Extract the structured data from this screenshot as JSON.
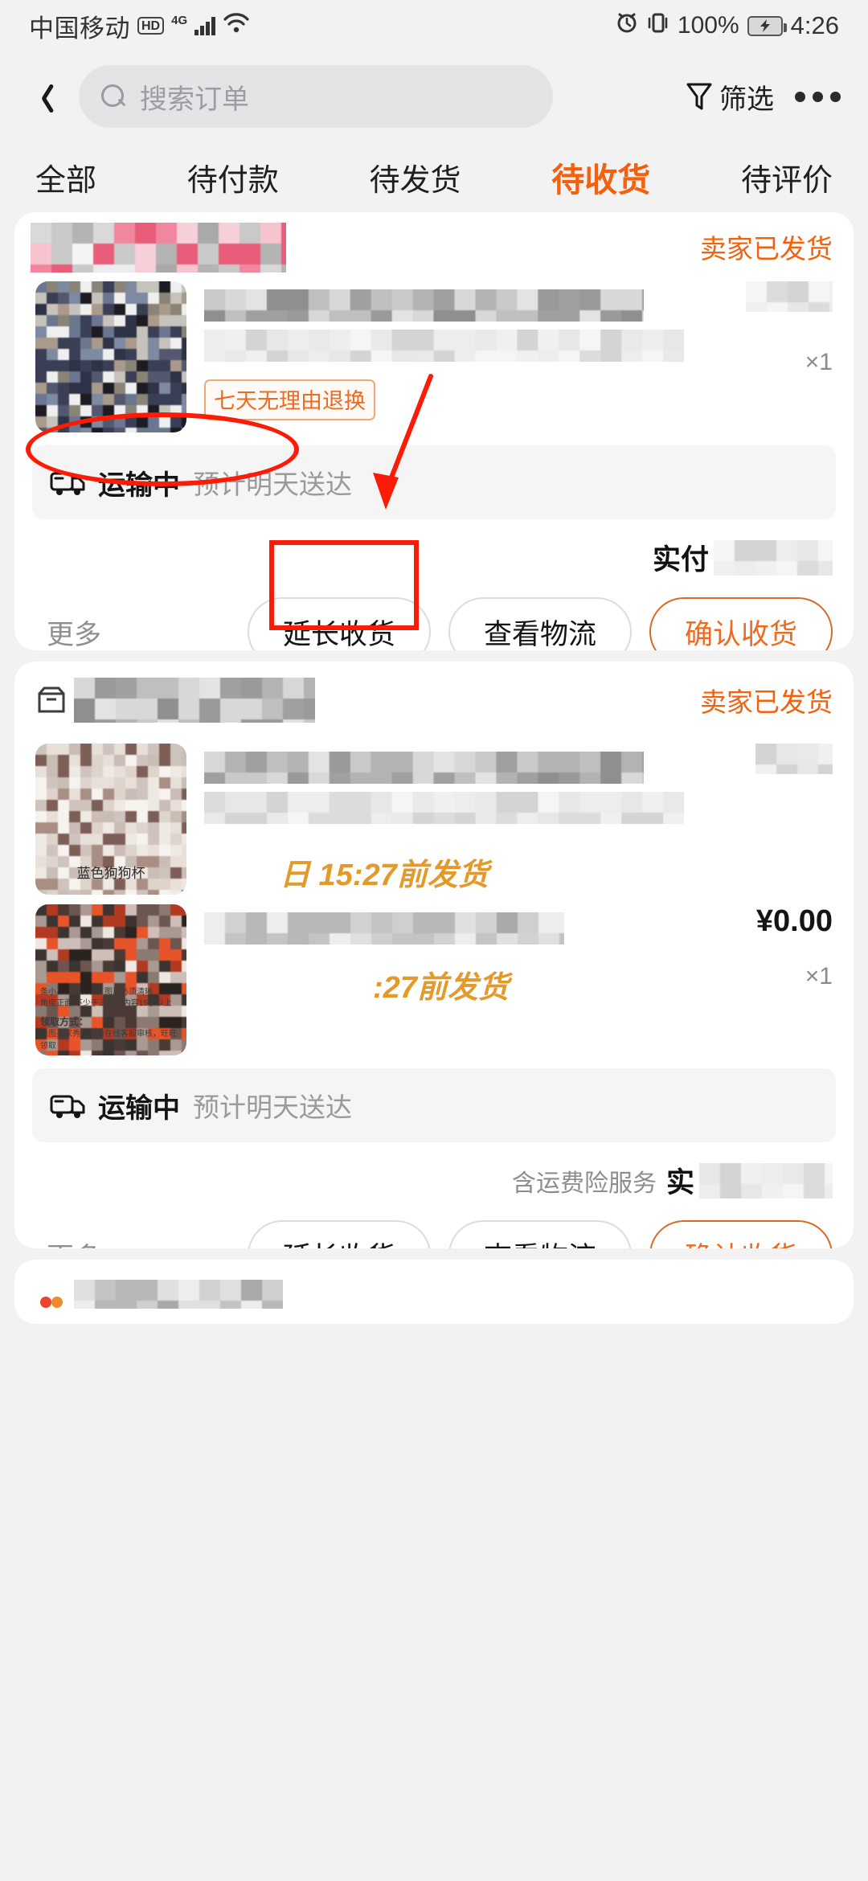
{
  "status_bar": {
    "carrier": "中国移动",
    "hd": "HD",
    "network": "4G",
    "battery_percent": "100%",
    "time": "4:26",
    "icons": [
      "alarm-icon",
      "vibrate-icon",
      "battery-charging-icon",
      "wifi-icon",
      "signal-bars-icon"
    ]
  },
  "header": {
    "back_icon": "chevron-left-icon",
    "search_placeholder": "搜索订单",
    "search_value": "",
    "filter_label": "筛选",
    "filter_icon": "funnel-icon",
    "more_icon": "more-dots-icon"
  },
  "tabs": [
    {
      "label": "全部",
      "active": false
    },
    {
      "label": "待付款",
      "active": false
    },
    {
      "label": "待发货",
      "active": false
    },
    {
      "label": "待收货",
      "active": true
    },
    {
      "label": "待评价",
      "active": false
    }
  ],
  "theme": {
    "accent": "#f4600c",
    "accent_button": "#ee6a20",
    "annotation_red": "#fb1b07",
    "page_bg": "#f2f2f2",
    "card_bg": "#ffffff",
    "muted_text": "#8f8f8f"
  },
  "orders": [
    {
      "shop_name": "",
      "shop_name_blurred": true,
      "status": "卖家已发货",
      "status_blurred_overlay": true,
      "goods": [
        {
          "title": "",
          "title_blurred": true,
          "tag": "七天无理由退换",
          "price": "",
          "price_blurred": true,
          "qty": "×1",
          "image_caption": ""
        }
      ],
      "logistics": {
        "state": "运输中",
        "eta": "预计明天送达",
        "icon": "truck-icon"
      },
      "payment": {
        "freight_note": "",
        "label": "实付",
        "amount": "",
        "amount_blurred": true
      },
      "buttons": [
        {
          "label": "更多",
          "style": "text"
        },
        {
          "label": "延长收货",
          "style": "outline"
        },
        {
          "label": "查看物流",
          "style": "outline"
        },
        {
          "label": "确认收货",
          "style": "primary"
        }
      ]
    },
    {
      "shop_name": "",
      "shop_name_blurred": true,
      "status": "卖家已发货",
      "goods": [
        {
          "title": "",
          "title_blurred": true,
          "deadline_text": "日 15:27前发货",
          "price": "",
          "qty": "",
          "image_caption": "蓝色狗狗杯"
        },
        {
          "title": "",
          "title_blurred": true,
          "deadline_text": ":27前发货",
          "price": "¥0.00",
          "qty": "×1",
          "image_caption": "",
          "image_text_lines": [
            "条小、、、、、、、、、、，图片必须清晰",
            "角度正面,不少于三张，内容15字以上",
            "领取方式：",
            "截图买家秀图片给在线客服审核，旺旺领取"
          ]
        }
      ],
      "logistics": {
        "state": "运输中",
        "eta": "预计明天送达",
        "icon": "truck-icon"
      },
      "payment": {
        "freight_note": "含运费险服务",
        "label": "实",
        "amount": "",
        "amount_blurred": true
      },
      "buttons": [
        {
          "label": "更多",
          "style": "text"
        },
        {
          "label": "延长收货",
          "style": "outline"
        },
        {
          "label": "查看物流",
          "style": "outline"
        },
        {
          "label": "确认收货",
          "style": "primary"
        }
      ]
    },
    {
      "shop_name": "",
      "status": "",
      "partial": true
    }
  ],
  "annotations": [
    {
      "type": "ellipse",
      "target": "logistics-row-order-1",
      "color": "#fb1b07"
    },
    {
      "type": "arrow",
      "from_to": "pointing-to-view-logistics",
      "color": "#fb1b07"
    },
    {
      "type": "rect",
      "target": "view-logistics-button-order-1",
      "color": "#fb1b07"
    }
  ]
}
